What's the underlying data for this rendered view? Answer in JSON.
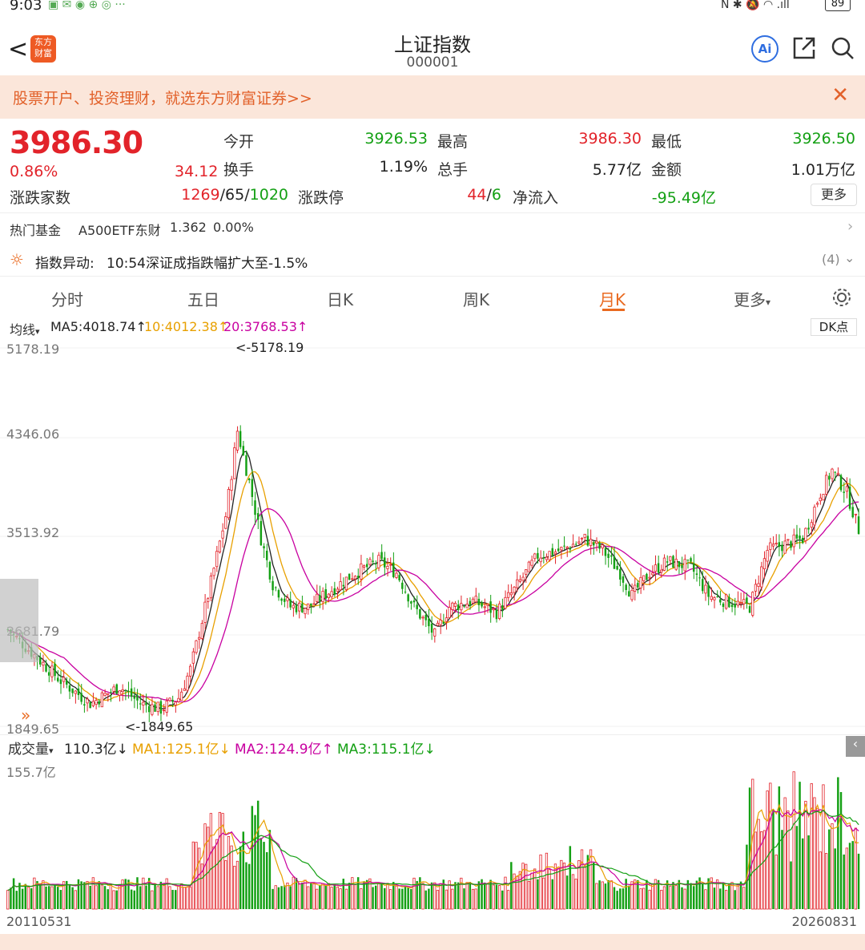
{
  "statusbar": {
    "time": "9:03",
    "battery": "89"
  },
  "header": {
    "title": "上证指数",
    "code": "000001"
  },
  "banner": {
    "text": "股票开户、投资理财，就选东方财富证券>>"
  },
  "quote": {
    "price": "3986.30",
    "change_pct": "0.86%",
    "change": "34.12",
    "open_label": "今开",
    "open": "3926.53",
    "high_label": "最高",
    "high": "3986.30",
    "low_label": "最低",
    "low": "3926.50",
    "turnover_label": "换手",
    "turnover": "1.19%",
    "volume_label": "总手",
    "volume": "5.77亿",
    "amount_label": "金额",
    "amount": "1.01万亿",
    "breadth_label": "涨跌家数",
    "breadth_up": "1269",
    "breadth_flat": "65",
    "breadth_down": "1020",
    "limit_label": "涨跌停",
    "limit_up": "44",
    "limit_down": "6",
    "netflow_label": "净流入",
    "netflow": "-95.49亿",
    "more": "更多"
  },
  "fund": {
    "label": "热门基金",
    "name": "A500ETF东财",
    "price": "1.362",
    "pct": "0.00%"
  },
  "alert": {
    "label": "指数异动:",
    "text": "10:54深证成指跌幅扩大至-1.5%",
    "count": "(4)"
  },
  "tabs": [
    "分时",
    "五日",
    "日K",
    "周K",
    "月K",
    "更多"
  ],
  "ma": {
    "label": "均线",
    "ma5": "MA5:4018.74↑",
    "ma10": "10:4012.38↑",
    "ma20": "20:3768.53↑",
    "dk": "DK点"
  },
  "colors": {
    "up": "#e2232a",
    "down": "#14a014",
    "ma5": "#222222",
    "ma10": "#e8a000",
    "ma20": "#c800a0",
    "accent": "#e96a20"
  },
  "chart_data": {
    "type": "candlestick",
    "y_axis_labels": [
      "5178.19",
      "4346.06",
      "3513.92",
      "2681.79",
      "1849.65"
    ],
    "ylim": [
      1849.65,
      5178.19
    ],
    "max_marker": "<-5178.19",
    "min_marker": "<-1849.65",
    "x_start": "20110531",
    "x_end": "20260831",
    "volume": {
      "label": "成交量",
      "value": "110.3亿↓",
      "ma1": "MA1:125.1亿↓",
      "ma2": "MA2:124.9亿↑",
      "ma3": "MA3:115.1亿↓",
      "max_label": "155.7亿"
    }
  }
}
